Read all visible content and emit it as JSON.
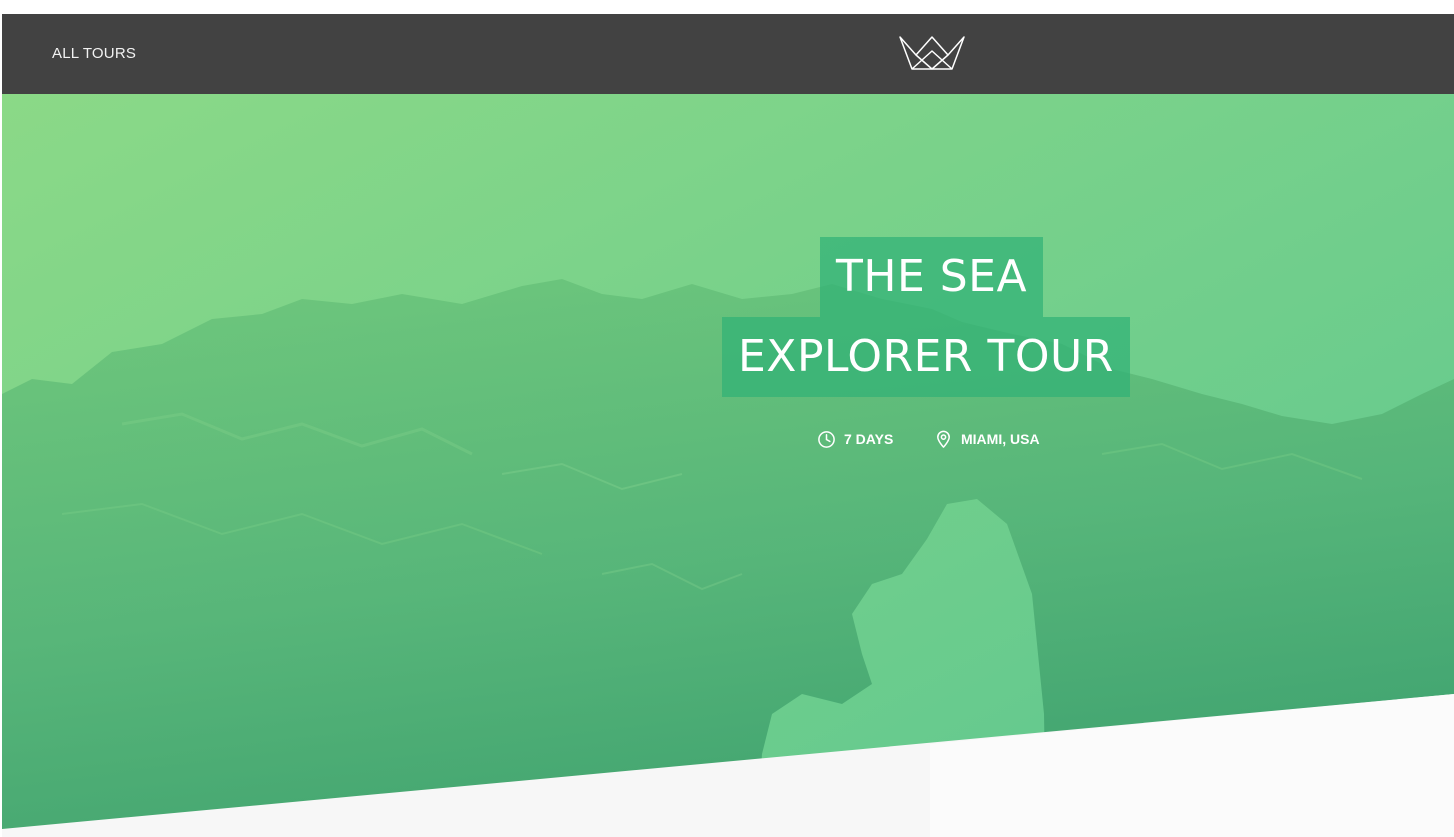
{
  "nav": {
    "all_tours": "ALL TOURS",
    "logo_icon": "crown-icon"
  },
  "hero": {
    "title_line1": "THE SEA",
    "title_line2": "EXPLORER TOUR",
    "duration": "7 DAYS",
    "location": "MIAMI, USA",
    "duration_icon": "clock-icon",
    "location_icon": "map-pin-icon"
  },
  "colors": {
    "navbar": "#424242",
    "accent_green": "#30b276",
    "hero_top": "#86d684",
    "hero_bottom": "#3aa878"
  }
}
